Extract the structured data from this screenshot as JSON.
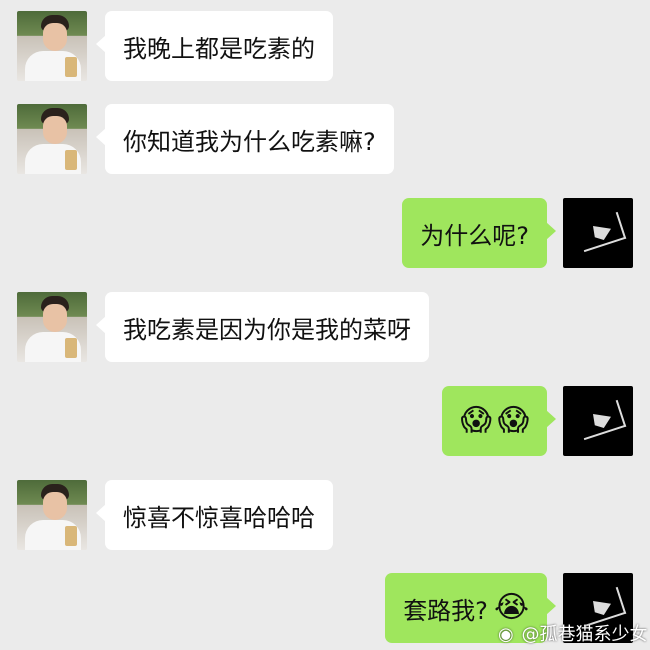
{
  "messages": [
    {
      "side": "left",
      "text": "我晚上都是吃素的",
      "avatar": "selfie-avatar"
    },
    {
      "side": "left",
      "text": "你知道我为什么吃素嘛?",
      "avatar": "selfie-avatar"
    },
    {
      "side": "right",
      "text": "为什么呢?",
      "avatar": "dark-avatar"
    },
    {
      "side": "left",
      "text": "我吃素是因为你是我的菜呀",
      "avatar": "selfie-avatar"
    },
    {
      "side": "right",
      "emojis": [
        "😱",
        "😱"
      ],
      "emoji_names": [
        "screaming-face-icon",
        "screaming-face-icon"
      ],
      "avatar": "dark-avatar"
    },
    {
      "side": "left",
      "text": "惊喜不惊喜哈哈哈",
      "avatar": "selfie-avatar"
    },
    {
      "side": "right",
      "text": "套路我?",
      "trailing_emoji": "😭",
      "trailing_emoji_name": "crying-face-icon",
      "avatar": "dark-avatar"
    }
  ],
  "watermark": {
    "icon": "weibo-logo-icon",
    "text": "@孤巷猫系少女"
  },
  "colors": {
    "background": "#ebebeb",
    "incoming_bubble": "#ffffff",
    "outgoing_bubble": "#9fe65d"
  }
}
